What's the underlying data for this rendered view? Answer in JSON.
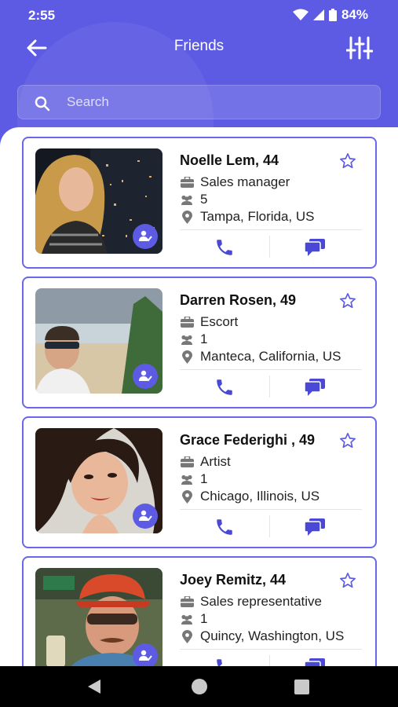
{
  "status_bar": {
    "time": "2:55",
    "battery": "84%"
  },
  "app_bar": {
    "title": "Friends"
  },
  "search": {
    "placeholder": "Search"
  },
  "friends": [
    {
      "name": "Noelle Lem, 44",
      "job": "Sales manager",
      "friends_count": "5",
      "location": "Tampa, Florida, US"
    },
    {
      "name": "Darren Rosen, 49",
      "job": "Escort",
      "friends_count": "1",
      "location": "Manteca, California, US"
    },
    {
      "name": "Grace Federighi , 49",
      "job": "Artist",
      "friends_count": "1",
      "location": "Chicago, Illinois, US"
    },
    {
      "name": "Joey Remitz, 44",
      "job": "Sales representative",
      "friends_count": "1",
      "location": "Quincy, Washington, US"
    }
  ],
  "icons": {
    "back": "arrow-left-icon",
    "filter": "sliders-icon",
    "search": "search-icon",
    "star": "star-outline-icon",
    "job": "briefcase-icon",
    "friends": "people-icon",
    "location": "pin-icon",
    "call": "phone-icon",
    "chat": "chat-icon",
    "verified": "user-check-icon"
  },
  "colors": {
    "primary": "#5d5be3",
    "card_border": "#6a68e8",
    "nav_bg": "#000000"
  }
}
